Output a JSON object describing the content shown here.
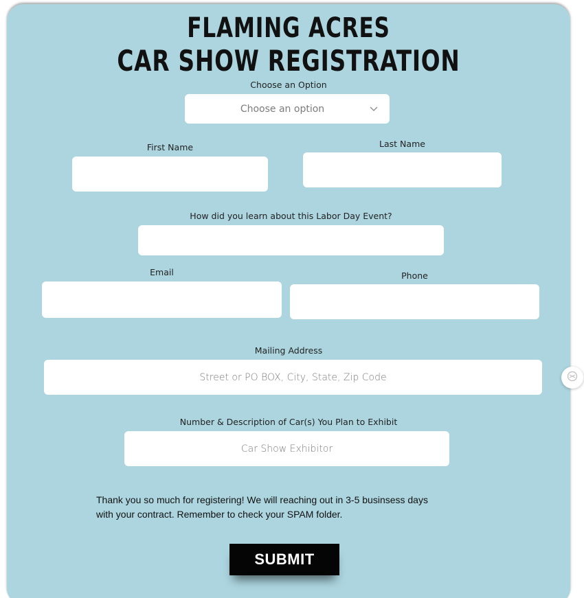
{
  "colors": {
    "background": "#acd5df",
    "field": "#ffffff",
    "submit": "#050505",
    "text": "#111111"
  },
  "header": {
    "title_line1": "FLAMING ACRES",
    "title_line2": "CAR SHOW REGISTRATION"
  },
  "form": {
    "option": {
      "label": "Choose an Option",
      "selected": "Choose an option",
      "icon": "chevron-down-icon"
    },
    "first_name": {
      "label": "First Name",
      "value": "",
      "placeholder": ""
    },
    "last_name": {
      "label": "Last Name",
      "value": "",
      "placeholder": ""
    },
    "referral": {
      "label": "How did you learn about this Labor Day Event?",
      "value": "",
      "placeholder": ""
    },
    "email": {
      "label": "Email",
      "value": "",
      "placeholder": ""
    },
    "phone": {
      "label": "Phone",
      "value": "",
      "placeholder": ""
    },
    "address": {
      "label": "Mailing Address",
      "value": "",
      "placeholder": "Street or PO BOX, City, State, Zip Code"
    },
    "cars": {
      "label": "Number & Description of Car(s) You Plan to Exhibit",
      "value": "",
      "placeholder": "Car Show Exhibitor"
    }
  },
  "note": {
    "line1": "Thank you so much for registering! We will reaching out in 3-5 businsess days",
    "line2": "with your contract. Remember to check your SPAM folder."
  },
  "submit_label": "SUBMIT",
  "side_widget": {
    "icon": "accessibility-icon"
  }
}
